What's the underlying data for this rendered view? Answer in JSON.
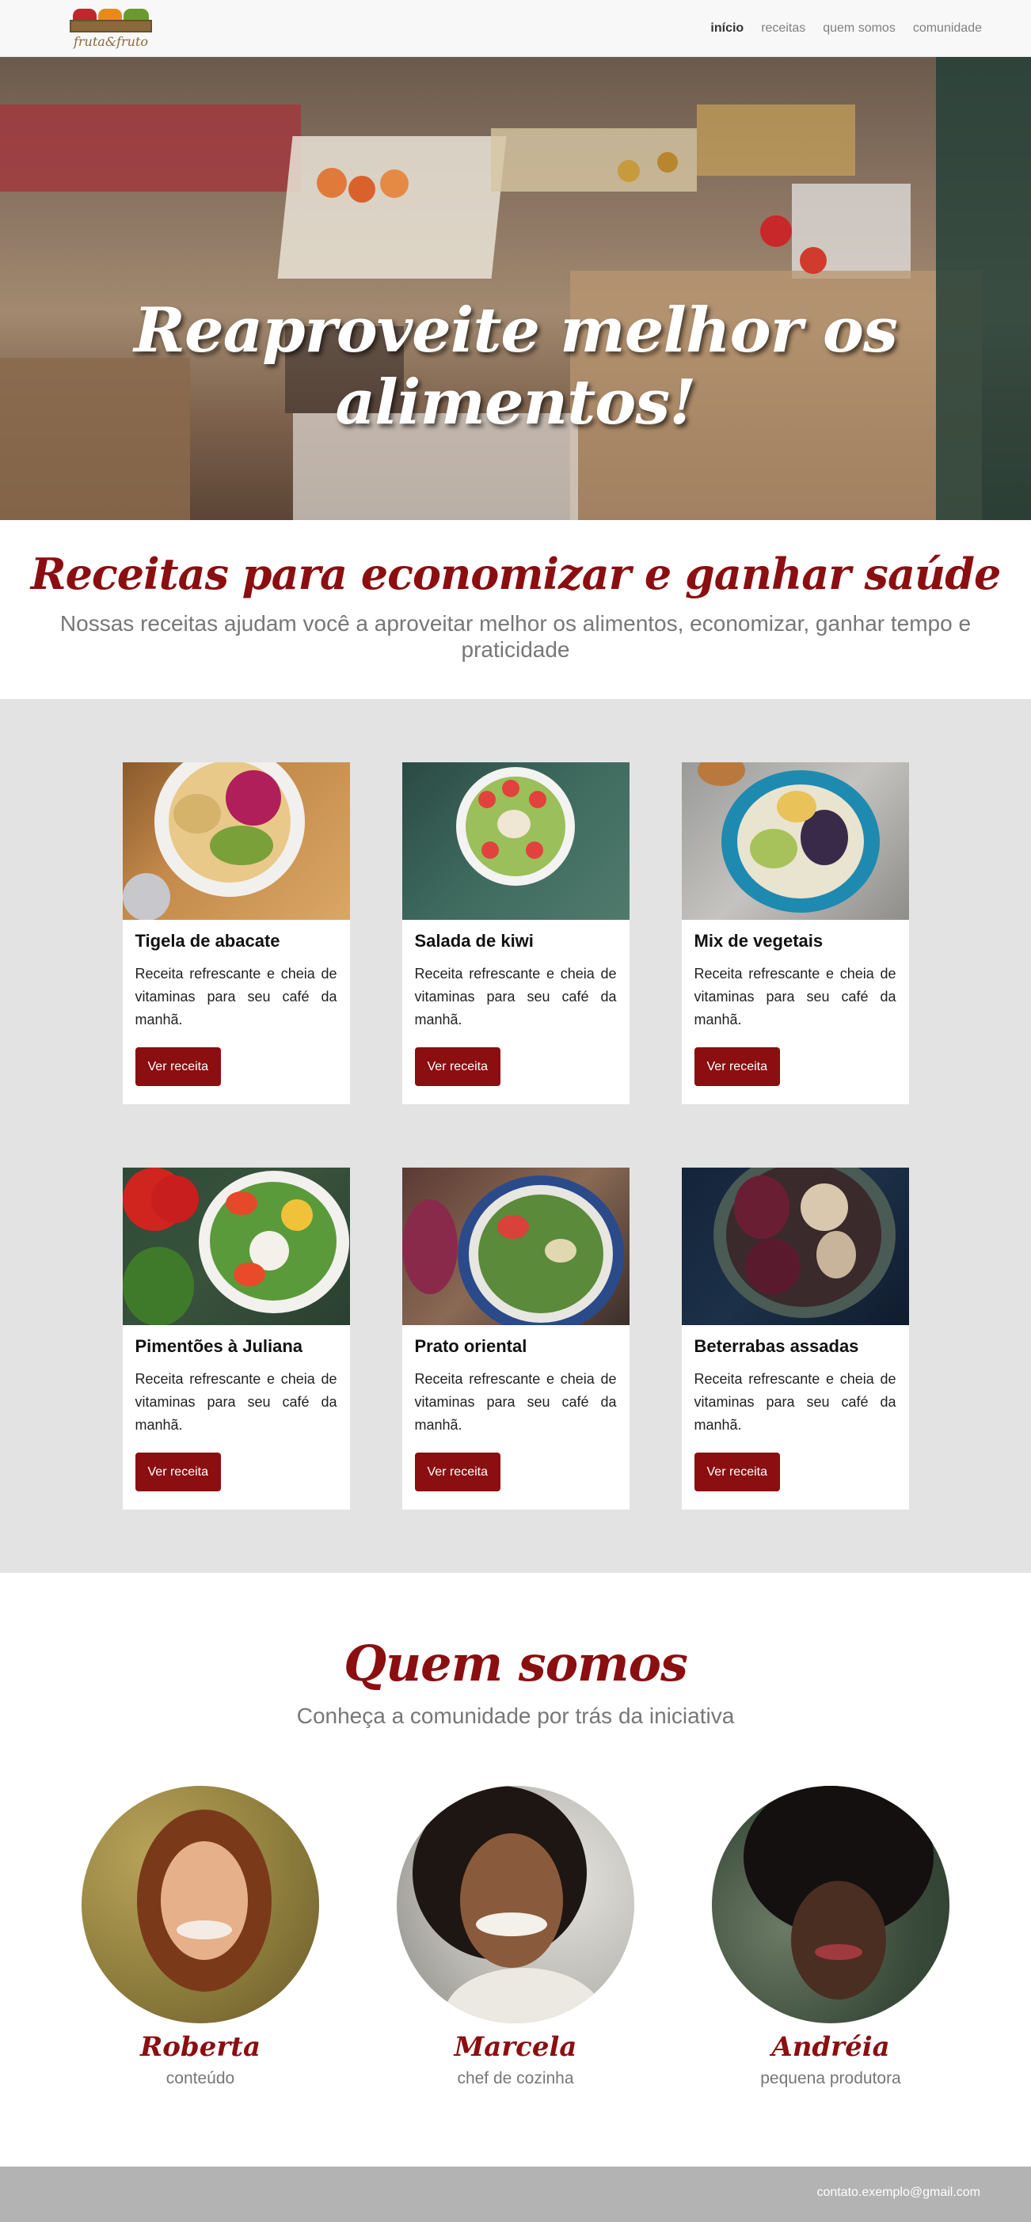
{
  "brand": {
    "logo_text": "fruta&fruto"
  },
  "nav": {
    "items": [
      {
        "label": "início",
        "active": true
      },
      {
        "label": "receitas",
        "active": false
      },
      {
        "label": "quem somos",
        "active": false
      },
      {
        "label": "comunidade",
        "active": false
      }
    ]
  },
  "hero": {
    "title": "Reaproveite melhor os alimentos!"
  },
  "intro": {
    "title": "Receitas para economizar e ganhar saúde",
    "subtitle": "Nossas receitas ajudam você a aproveitar melhor os alimentos, economizar, ganhar tempo e praticidade"
  },
  "recipes": [
    {
      "title": "Tigela de abacate",
      "description": "Receita refrescante e cheia de vitaminas para seu café da manhã.",
      "button": "Ver receita"
    },
    {
      "title": "Salada de kiwi",
      "description": "Receita refrescante e cheia de vitaminas para seu café da manhã.",
      "button": "Ver receita"
    },
    {
      "title": "Mix de vegetais",
      "description": "Receita refrescante e cheia de vitaminas para seu café da manhã.",
      "button": "Ver receita"
    },
    {
      "title": "Pimentões à Juliana",
      "description": "Receita refrescante e cheia de vitaminas para seu café da manhã.",
      "button": "Ver receita"
    },
    {
      "title": "Prato oriental",
      "description": "Receita refrescante e cheia de vitaminas para seu café da manhã.",
      "button": "Ver receita"
    },
    {
      "title": "Beterrabas assadas",
      "description": "Receita refrescante e cheia de vitaminas para seu café da manhã.",
      "button": "Ver receita"
    }
  ],
  "about": {
    "title": "Quem somos",
    "subtitle": "Conheça a comunidade por trás da iniciativa",
    "people": [
      {
        "name": "Roberta",
        "role": "conteúdo"
      },
      {
        "name": "Marcela",
        "role": "chef de cozinha"
      },
      {
        "name": "Andréia",
        "role": "pequena produtora"
      }
    ]
  },
  "footer": {
    "email": "contato.exemplo@gmail.com"
  },
  "colors": {
    "accent": "#8b0e11",
    "recipes_bg": "#e3e3e3",
    "footer_bg": "#b3b3b3"
  }
}
